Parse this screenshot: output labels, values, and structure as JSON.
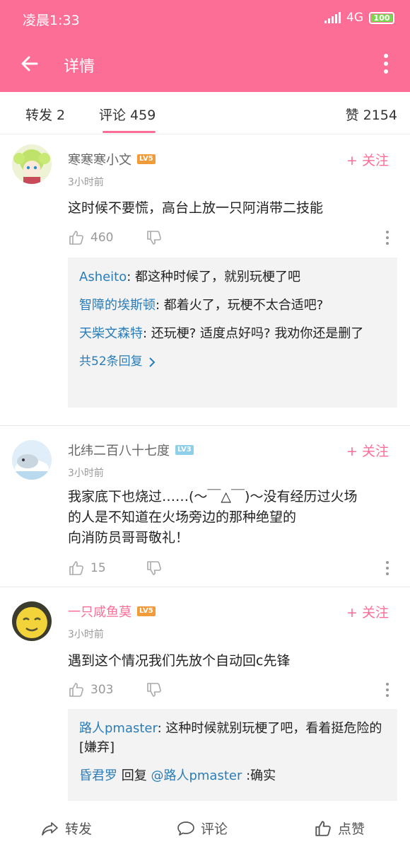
{
  "status_bar": {
    "time": "凌晨1:33",
    "network": "4G",
    "battery": "100"
  },
  "app_bar": {
    "title": "详情",
    "back_icon": "arrow-left-icon",
    "more_icon": "more-vertical-icon"
  },
  "tabs": {
    "forward": "转发 2",
    "comment": "评论 459",
    "like": "赞 2154"
  },
  "comments": [
    {
      "user": "寒寒寒小文",
      "level": "LV5",
      "follow": "+ 关注",
      "time": "3小时前",
      "text": "这时候不要慌，高台上放一只阿消带二技能",
      "likes": "460",
      "replies": [
        {
          "name": "Asheito",
          "text": ": 都这种时候了，就别玩梗了吧"
        },
        {
          "name": "智障的埃斯顿",
          "text": ": 都着火了，玩梗不太合适吧?"
        },
        {
          "name": "天柴文森特",
          "text": ": 还玩梗? 适度点好吗? 我劝你还是删了"
        }
      ],
      "more_replies": "共52条回复"
    },
    {
      "user": "北纬二百八十七度",
      "level": "LV3",
      "follow": "+ 关注",
      "time": "3小时前",
      "text_lines": [
        "我家底下也烧过……(〜￣△￣)〜没有经历过火场",
        "的人是不知道在火场旁边的那种绝望的",
        "向消防员哥哥敬礼！"
      ],
      "likes": "15"
    },
    {
      "user": "一只咸鱼莫",
      "level": "LV5",
      "follow": "+ 关注",
      "time": "3小时前",
      "text": "遇到这个情况我们先放个自动回c先锋",
      "likes": "303",
      "replies": [
        {
          "name": "路人pmaster",
          "text": ": 这种时候就别玩梗了吧，看着挺危险的[嫌弃]"
        },
        {
          "name": "昏君罗",
          "mid": " 回复 ",
          "mention": "@路人pmaster",
          "text": " :确实"
        }
      ]
    }
  ],
  "bottom_bar": {
    "forward": "转发",
    "comment": "评论",
    "like": "点赞"
  },
  "colors": {
    "brand_pink": "#fc6e96",
    "link_blue": "#2a7db8",
    "level_orange": "#f29b3a",
    "level_blue": "#8ed0ea"
  }
}
